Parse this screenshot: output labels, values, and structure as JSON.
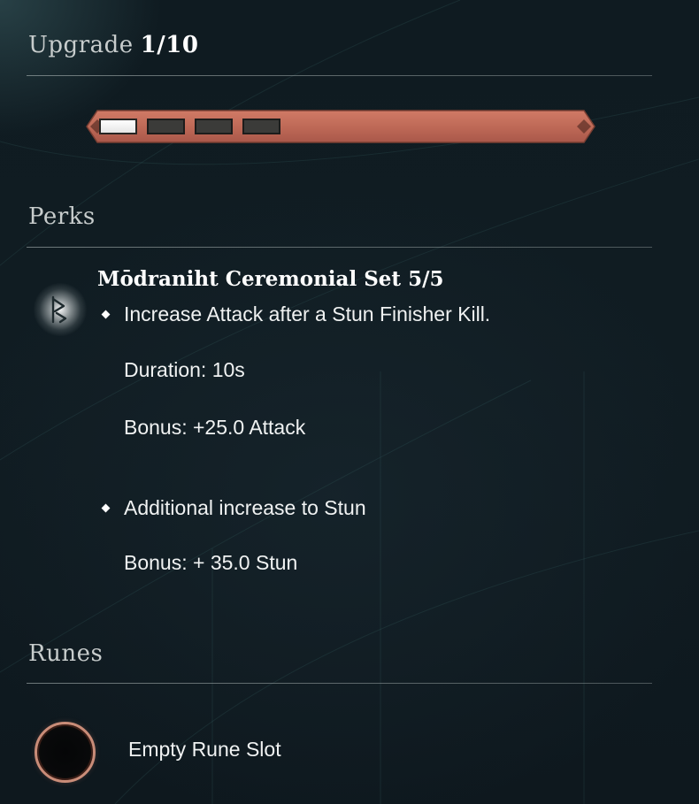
{
  "upgrade": {
    "label": "Upgrade",
    "value": "1/10",
    "level": 1,
    "visible_pips": 4,
    "filled_pips": 1,
    "bar_color": "#c8705e"
  },
  "perks": {
    "heading": "Perks",
    "set_icon": "rune-glyph-icon",
    "set_title": "Mōdraniht Ceremonial Set 5/5",
    "entries": [
      {
        "description": "Increase Attack after a Stun Finisher Kill.",
        "details": [
          "Duration: 10s",
          "Bonus: +25.0 Attack"
        ]
      },
      {
        "description": "Additional increase to Stun",
        "details": [
          "Bonus: + 35.0 Stun"
        ]
      }
    ]
  },
  "runes": {
    "heading": "Runes",
    "slot_label": "Empty Rune Slot",
    "slot_icon": "empty-rune-slot-icon",
    "slot_ring_color": "#c98c78"
  }
}
